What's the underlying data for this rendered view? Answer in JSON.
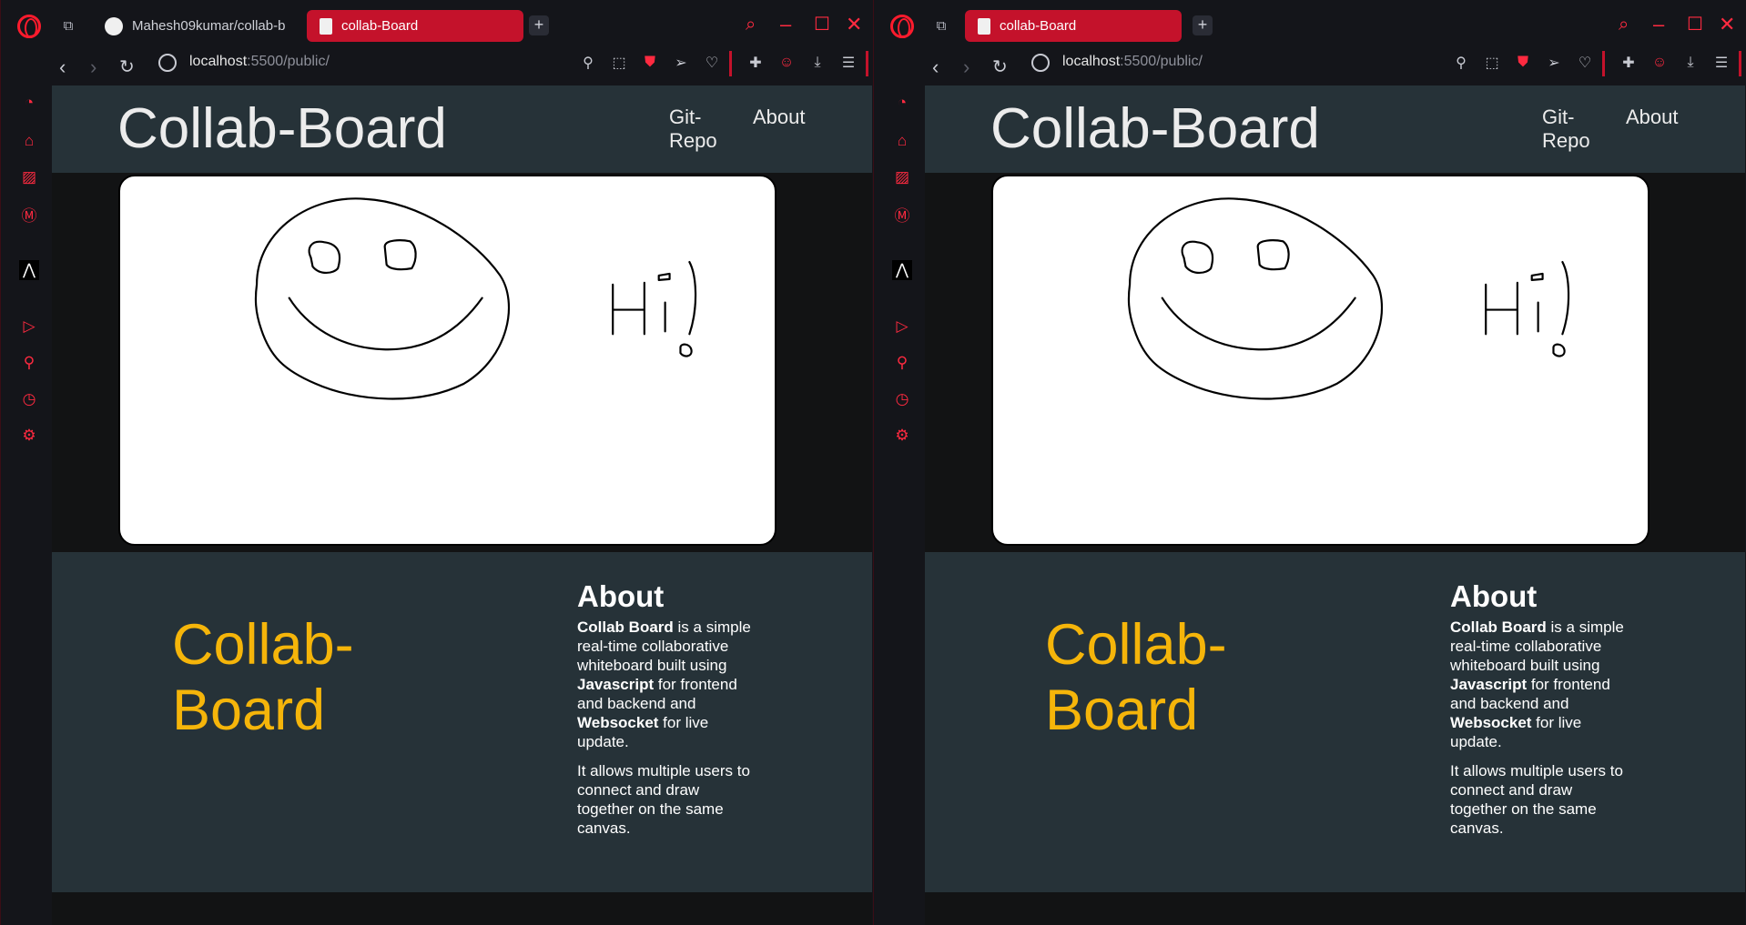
{
  "windows": [
    {
      "tabs": [
        {
          "label": "Mahesh09kumar/collab-b",
          "active": false
        },
        {
          "label": "collab-Board",
          "active": true
        }
      ]
    },
    {
      "tabs": [
        {
          "label": "collab-Board",
          "active": true
        }
      ]
    }
  ],
  "address": {
    "host": "localhost",
    "rest": ":5500/public/"
  },
  "site": {
    "brand": "Collab-Board",
    "nav": {
      "git_line1": "Git-",
      "git_line2": "Repo",
      "about": "About"
    },
    "canvas_text": "Hi!",
    "footer": {
      "brand_line1": "Collab-",
      "brand_line2": "Board",
      "about_title": "About",
      "p1": {
        "b1": "Collab Board",
        "t1": " is a simple real-time collaborative whiteboard built using ",
        "b2": "Javascript",
        "t2": " for frontend and backend and ",
        "b3": "Websocket",
        "t3": " for live update."
      },
      "p2": "It allows multiple users to connect and draw together on the same canvas."
    }
  },
  "colors": {
    "accent": "#c4122b",
    "navbar": "#263238",
    "brand_yellow": "#f5b50a"
  }
}
